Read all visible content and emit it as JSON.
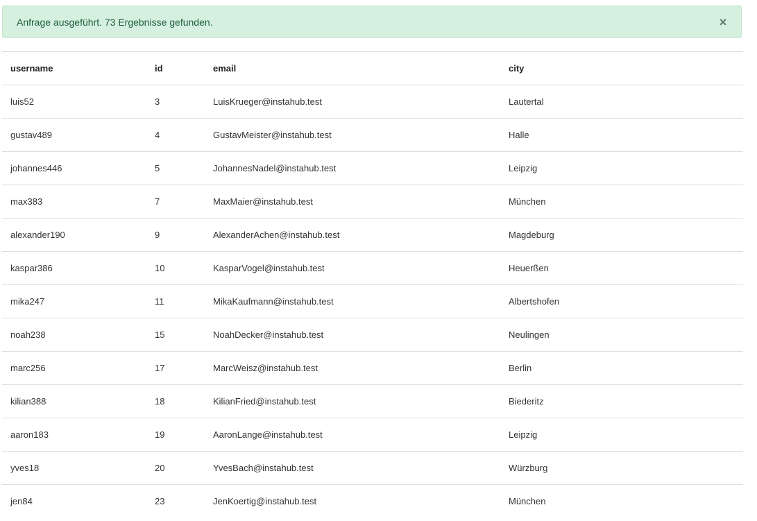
{
  "alert": {
    "message": "Anfrage ausgeführt. 73 Ergebnisse gefunden.",
    "close_icon": "×"
  },
  "table": {
    "columns": [
      "username",
      "id",
      "email",
      "city"
    ],
    "rows": [
      [
        "luis52",
        "3",
        "LuisKrueger@instahub.test",
        "Lautertal"
      ],
      [
        "gustav489",
        "4",
        "GustavMeister@instahub.test",
        "Halle"
      ],
      [
        "johannes446",
        "5",
        "JohannesNadel@instahub.test",
        "Leipzig"
      ],
      [
        "max383",
        "7",
        "MaxMaier@instahub.test",
        "München"
      ],
      [
        "alexander190",
        "9",
        "AlexanderAchen@instahub.test",
        "Magdeburg"
      ],
      [
        "kaspar386",
        "10",
        "KasparVogel@instahub.test",
        "Heuerßen"
      ],
      [
        "mika247",
        "11",
        "MikaKaufmann@instahub.test",
        "Albertshofen"
      ],
      [
        "noah238",
        "15",
        "NoahDecker@instahub.test",
        "Neulingen"
      ],
      [
        "marc256",
        "17",
        "MarcWeisz@instahub.test",
        "Berlin"
      ],
      [
        "kilian388",
        "18",
        "KilianFried@instahub.test",
        "Biederitz"
      ],
      [
        "aaron183",
        "19",
        "AaronLange@instahub.test",
        "Leipzig"
      ],
      [
        "yves18",
        "20",
        "YvesBach@instahub.test",
        "Würzburg"
      ],
      [
        "jen84",
        "23",
        "JenKoertig@instahub.test",
        "München"
      ]
    ]
  }
}
